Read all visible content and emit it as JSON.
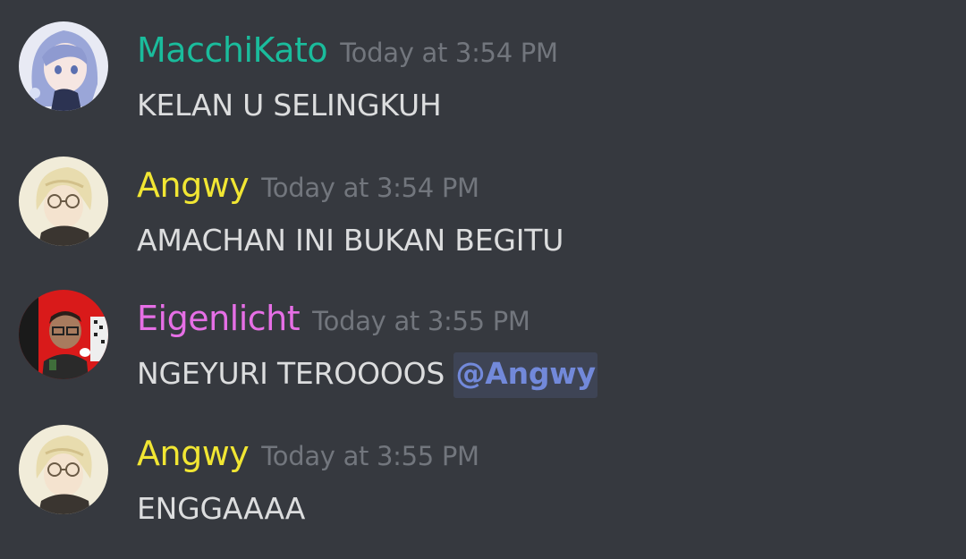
{
  "colors": {
    "background": "#36393f",
    "text": "#dcddde",
    "timestamp": "#72767d",
    "mention": "#7289da"
  },
  "messages": [
    {
      "username": "MacchiKato",
      "username_color": "#1abc9c",
      "timestamp": "Today at 3:54 PM",
      "content": "KELAN U SELINGKUH",
      "avatar_icon": "anime-girl-blue-hair-avatar"
    },
    {
      "username": "Angwy",
      "username_color": "#f1e633",
      "timestamp": "Today at 3:54 PM",
      "content": "AMACHAN INI BUKAN BEGITU",
      "avatar_icon": "anime-boy-glasses-avatar"
    },
    {
      "username": "Eigenlicht",
      "username_color": "#e66fe6",
      "timestamp": "Today at 3:55 PM",
      "content": "NGEYURI TEROOOOS",
      "mention": "@Angwy",
      "avatar_icon": "red-glasses-man-avatar"
    },
    {
      "username": "Angwy",
      "username_color": "#f1e633",
      "timestamp": "Today at 3:55 PM",
      "content": "ENGGAAAA",
      "avatar_icon": "anime-boy-glasses-avatar"
    }
  ]
}
